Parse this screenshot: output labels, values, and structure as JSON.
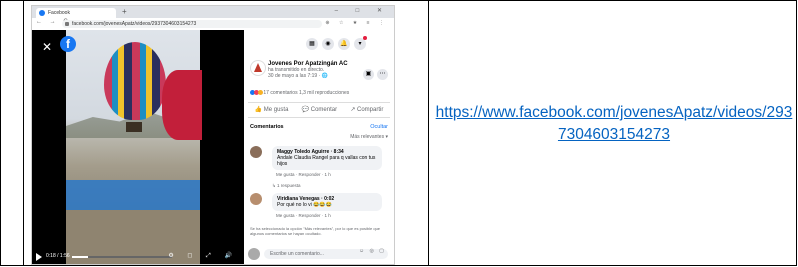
{
  "browser": {
    "tab_title": "Facebook",
    "new_tab": "+",
    "window_controls": "–  □  ✕",
    "nav": "←  →  C",
    "url": "facebook.com/jovenesApatz/videos/2937304603154273",
    "addr_icons": "⊕ ☆ ★ ≡ ⋮"
  },
  "video": {
    "close": "✕",
    "logo": "f",
    "time": "0:18 / 1:56",
    "progress": 0.16,
    "controls": "⚙ ◻ ⤢ 🔊"
  },
  "panel": {
    "top_buttons": [
      "▦",
      "◉",
      "🔔",
      "▾"
    ],
    "page_name": "Jovenes Por Apatzingán AC",
    "page_subtitle": "ha transmitido en directo.",
    "post_date": "30 de mayo a las 7:19 · 🌐",
    "stats": "17 comentarios  1,3 mil reproducciones",
    "actions": [
      "👍 Me gusta",
      "💬 Comentar",
      "↗ Compartir"
    ],
    "comments_label": "Comentarios",
    "hide_label": "Ocultar",
    "sort_label": "Más relevantes ▾",
    "comments": [
      {
        "author": "Maggy Toledo Aguirre · 8:34",
        "text": "Andale Claudia Rangel para q vallas con tus hijos",
        "meta": "Me gusta · Responder · 1 h",
        "replies": "↳ 1 respuesta"
      },
      {
        "author": "Viridiana Venegas · 0:02",
        "text": "Por qué no lo vi 😂😂😂",
        "meta": "Me gusta · Responder · 1 h",
        "replies": ""
      }
    ],
    "filter_note": "Se ha seleccionado la opción \"Más relevantes\", por lo que es posible que algunos comentarios se hayan ocultado.",
    "write_placeholder": "Escribe un comentario...",
    "write_icons": "☺ ◎ ▢"
  },
  "link": {
    "text": "https://www.facebook.com/jovenesApatz/videos/2937304603154273"
  },
  "colors": {
    "facebook_blue": "#1877f2",
    "link_blue": "#0563c1",
    "badge_red": "#e41e3f"
  }
}
